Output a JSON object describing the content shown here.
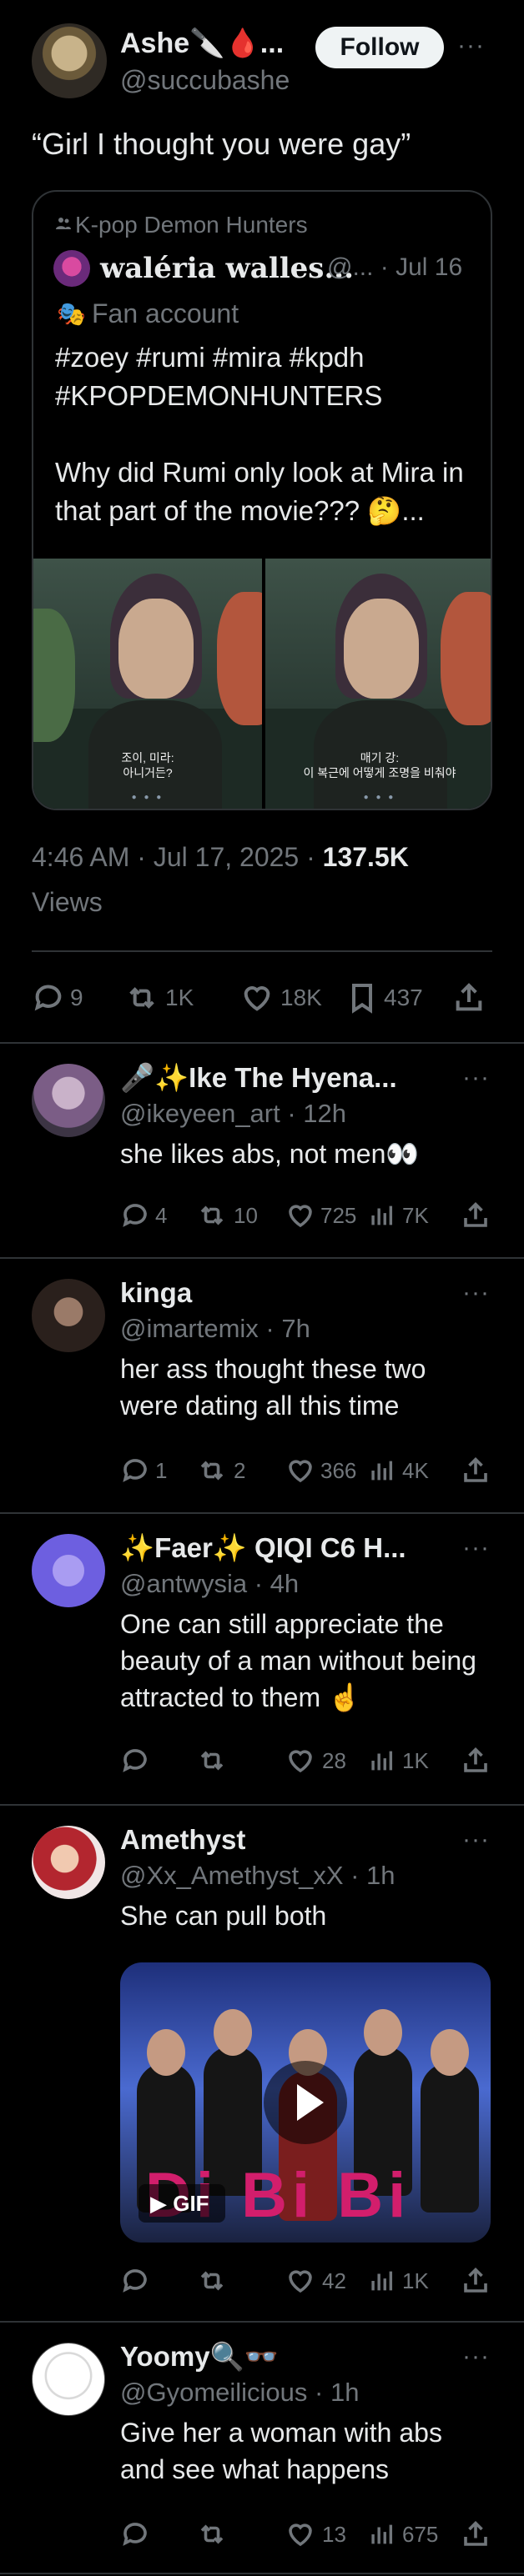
{
  "post": {
    "author_name": "Ashe🔪🩸...",
    "author_handle": "@succubashe",
    "follow_label": "Follow",
    "more": "···",
    "text": "“Girl I thought you were gay”",
    "timestamp": "4:46 AM · Jul 17, 2025 · ",
    "views_count": "137.5K",
    "views_word": "Views",
    "actions": {
      "replies": "9",
      "reposts": "1K",
      "likes": "18K",
      "bookmarks": "437"
    }
  },
  "quote": {
    "community": "K-pop Demon Hunters",
    "author_name": "waléria walles...",
    "meta": "@... · Jul 16",
    "fan_label": "Fan account",
    "body": "#zoey #rumi #mira #kpdh\n#KPOPDEMONHUNTERS\n\nWhy did Rumi only look at Mira in that part of the movie??? 🤔...",
    "image1_caption": "조이, 미라:\n아니거든?",
    "image2_caption": "매기 강:\n이 복근에 어떻게 조명을 비춰야"
  },
  "replies": [
    {
      "name": "🎤✨Ike The Hyena...",
      "handle": "@ikeyeen_art · 12h",
      "text": "she likes abs, not men👀",
      "replies": "4",
      "reposts": "10",
      "likes": "725",
      "views": "7K",
      "avatar_color": "#6d5a7a"
    },
    {
      "name": "kinga",
      "handle": "@imartemix · 7h",
      "text": "her ass thought these two were dating all this time",
      "replies": "1",
      "reposts": "2",
      "likes": "366",
      "views": "4K",
      "avatar_color": "#3a2f2a"
    },
    {
      "name": "✨Faer✨ QIQI C6 H...",
      "handle": "@antwysia · 4h",
      "text": "One can still appreciate the beauty of a man without being attracted to them ☝️",
      "replies": "",
      "reposts": "",
      "likes": "28",
      "views": "1K",
      "avatar_color": "#7a6ee0"
    },
    {
      "name": "Amethyst",
      "handle": "@Xx_Amethyst_xX · 1h",
      "text": "She can pull both",
      "replies": "",
      "reposts": "",
      "likes": "42",
      "views": "1K",
      "gif_label": "GIF",
      "gif_overlay": "Di Bi Bi",
      "avatar_color": "#b33a3a"
    },
    {
      "name": "Yoomy🔍👓",
      "handle": "@Gyomeilicious · 1h",
      "text": "Give her a woman with abs and see what happens",
      "replies": "",
      "reposts": "",
      "likes": "13",
      "views": "675",
      "avatar_color": "#f2f2f2"
    }
  ]
}
